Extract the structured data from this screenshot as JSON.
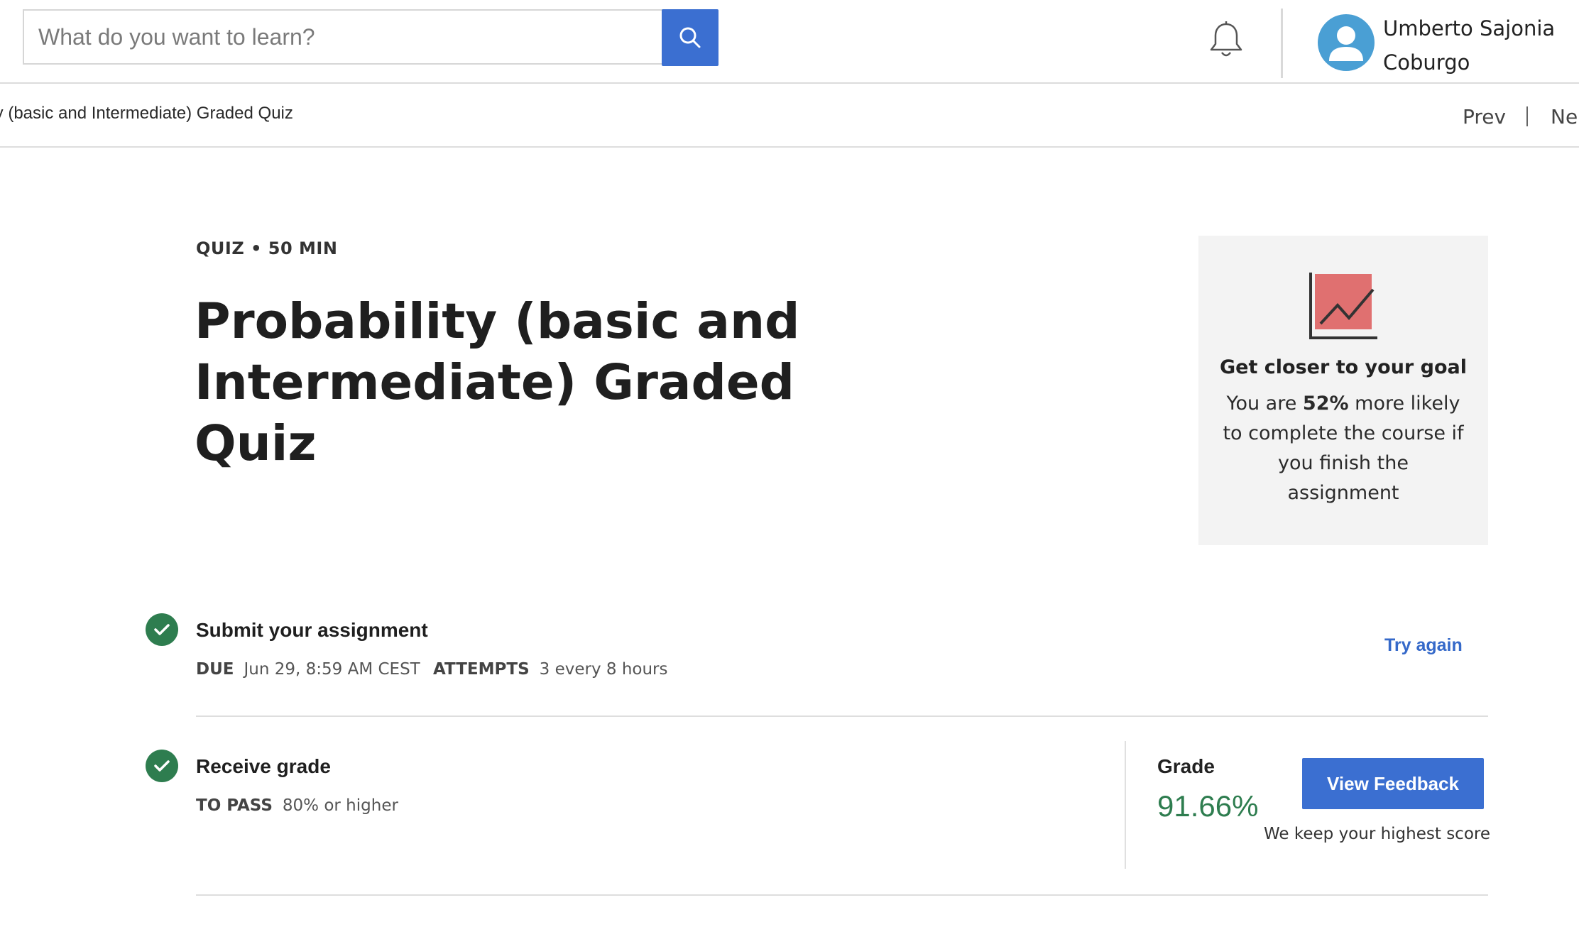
{
  "header": {
    "search": {
      "placeholder": "What do you want to learn?",
      "value": ""
    },
    "icons": {
      "search": "search-icon",
      "notifications": "bell-icon",
      "avatar": "user-avatar-icon"
    },
    "user": {
      "name": "Umberto Sajonia Coburgo"
    }
  },
  "breadcrumb": {
    "text": "ty (basic and Intermediate) Graded Quiz",
    "prev_label": "Prev",
    "next_label": "Ne"
  },
  "main": {
    "eyebrow": "QUIZ • 50 MIN",
    "title": "Probability (basic and Intermediate) Graded Quiz"
  },
  "goal_card": {
    "icon": "trend-chart-icon",
    "title": "Get closer to your goal",
    "text_before": "You are ",
    "percent": "52%",
    "text_after": " more likely to complete the course if you finish the assignment"
  },
  "steps": {
    "submit": {
      "title": "Submit your assignment",
      "due_label": "DUE",
      "due_value": "Jun 29, 8:59 AM CEST",
      "attempts_label": "ATTEMPTS",
      "attempts_value": "3 every 8 hours",
      "action_label": "Try again"
    },
    "grade": {
      "title": "Receive grade",
      "pass_label": "TO PASS",
      "pass_value": "80% or higher",
      "grade_label": "Grade",
      "grade_value": "91.66%",
      "feedback_button": "View Feedback",
      "note": "We keep your highest score"
    }
  },
  "colors": {
    "accent": "#3b6fd1",
    "success": "#2e7d4f",
    "avatar": "#4a9fd4",
    "goal_chart": "#e07070"
  }
}
